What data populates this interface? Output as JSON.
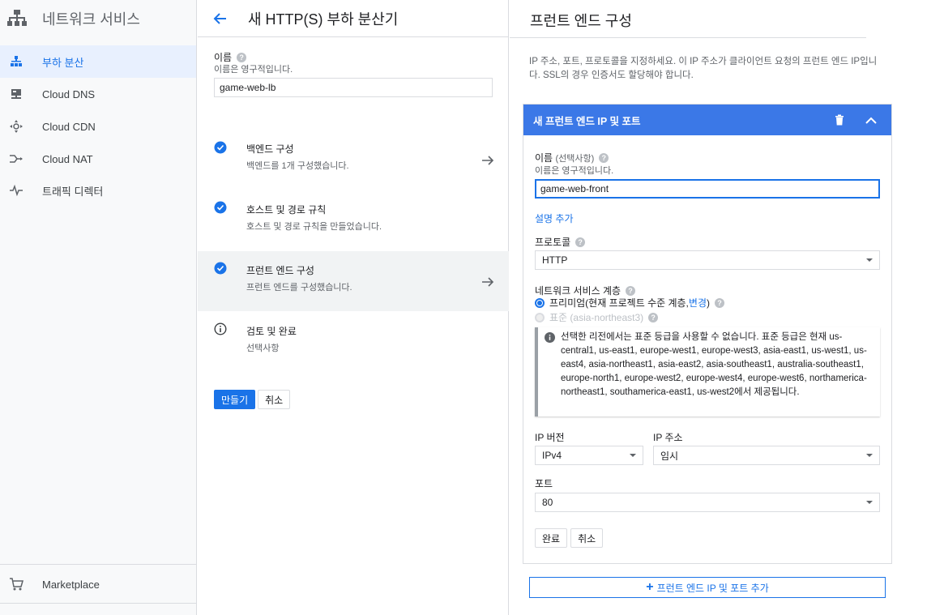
{
  "sidebar": {
    "title": "네트워크 서비스",
    "items": [
      {
        "label": "부하 분산",
        "icon": "load-balancing-icon",
        "active": true
      },
      {
        "label": "Cloud DNS",
        "icon": "dns-icon"
      },
      {
        "label": "Cloud CDN",
        "icon": "cdn-icon"
      },
      {
        "label": "Cloud NAT",
        "icon": "nat-icon"
      },
      {
        "label": "트래픽 디렉터",
        "icon": "traffic-director-icon"
      }
    ],
    "marketplace": "Marketplace"
  },
  "middle": {
    "title": "새 HTTP(S) 부하 분산기",
    "name_label": "이름",
    "name_hint": "이름은 영구적입니다.",
    "name_value": "game-web-lb",
    "steps": [
      {
        "title": "백엔드 구성",
        "subtitle": "백엔드를 1개 구성했습니다.",
        "status": "done",
        "arrow": true
      },
      {
        "title": "호스트 및 경로 규칙",
        "subtitle": "호스트 및 경로 규칙을 만들었습니다.",
        "status": "done",
        "arrow": false
      },
      {
        "title": "프런트 엔드 구성",
        "subtitle": "프런트 엔드를 구성했습니다.",
        "status": "done",
        "arrow": true,
        "selected": true
      },
      {
        "title": "검토 및 완료",
        "subtitle": "선택사항",
        "status": "info",
        "arrow": false
      }
    ],
    "create_label": "만들기",
    "cancel_label": "취소"
  },
  "right": {
    "title": "프런트 엔드 구성",
    "description": "IP 주소, 포트, 프로토콜을 지정하세요. 이 IP 주소가 클라이언트 요청의 프런트 엔드 IP입니다. SSL의 경우 인증서도 할당해야 합니다.",
    "card": {
      "title": "새 프런트 엔드 IP 및 포트",
      "name_label": "이름",
      "name_optional": "(선택사항)",
      "name_hint": "이름은 영구적입니다.",
      "name_value": "game-web-front",
      "add_description": "설명 추가",
      "protocol_label": "프로토콜",
      "protocol_value": "HTTP",
      "tier_label": "네트워크 서비스 계층",
      "tier_premium_prefix": "프리미엄(현재 프로젝트 수준 계층, ",
      "tier_premium_link": "변경",
      "tier_premium_suffix": ")",
      "tier_standard": "표준 (asia-northeast3)",
      "info_text": "선택한 리전에서는 표준 등급을 사용할 수 없습니다. 표준 등급은 현재 us-central1, us-east1, europe-west1, europe-west3, asia-east1, us-west1, us-east4, asia-northeast1, asia-east2, asia-southeast1, australia-southeast1, europe-north1, europe-west2, europe-west4, europe-west6, northamerica-northeast1, southamerica-east1, us-west2에서 제공됩니다.",
      "ip_version_label": "IP 버전",
      "ip_version_value": "IPv4",
      "ip_address_label": "IP 주소",
      "ip_address_value": "임시",
      "port_label": "포트",
      "port_value": "80",
      "done_label": "완료",
      "cancel_label": "취소"
    },
    "add_frontend_label": "프런트 엔드 IP 및 포트 추가"
  },
  "colors": {
    "accent": "#1a73e8",
    "card_header": "#3b78e7"
  }
}
